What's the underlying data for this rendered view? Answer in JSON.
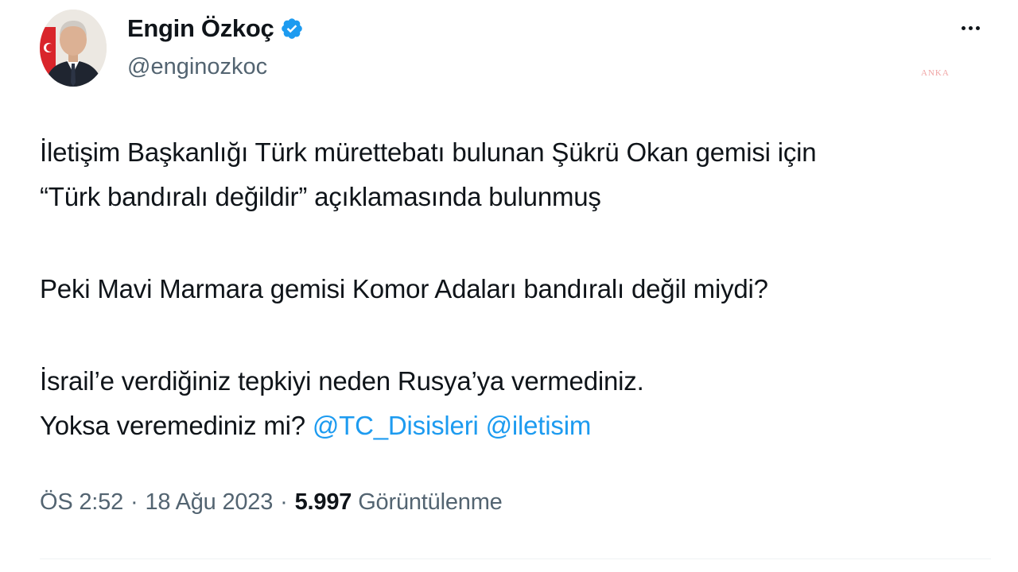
{
  "author": {
    "name": "Engin Özkoç",
    "handle": "@enginozkoc",
    "verified": true
  },
  "icons": {
    "avatar": "avatar-photo",
    "verified": "verified-badge-icon",
    "more": "more-options-icon",
    "verified_color": "#1d9bf0"
  },
  "watermark": "ANKA",
  "tweet": {
    "paragraph1_line1": "İletişim Başkanlığı Türk mürettebatı bulunan Şükrü Okan gemisi için",
    "paragraph1_line2": "“Türk bandıralı değildir” açıklamasında bulunmuş",
    "paragraph2": "Peki Mavi Marmara gemisi Komor Adaları bandıralı değil miydi?",
    "paragraph3_line1": "İsrail’e verdiğiniz tepkiyi neden Rusya’ya vermediniz.",
    "paragraph3_line2": "Yoksa veremediniz mi?",
    "mentions": [
      "@TC_Disisleri",
      "@iletisim"
    ],
    "mention_color": "#1d9bf0"
  },
  "meta": {
    "time": "ÖS 2:52",
    "date": "18 Ağu 2023",
    "separator": "·",
    "views_count": "5.997",
    "views_label": "Görüntülenme"
  }
}
